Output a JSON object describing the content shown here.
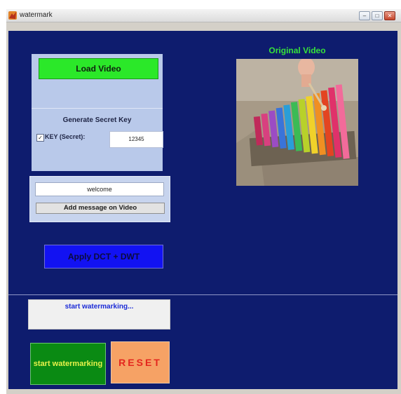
{
  "window": {
    "title": "watermark",
    "controls": {
      "minimize": "–",
      "maximize": "□",
      "close": "✕"
    }
  },
  "video_panel": {
    "title": "Original Video"
  },
  "load": {
    "button_label": "Load Video"
  },
  "secret_key": {
    "heading": "Generate Secret Key",
    "checkbox_label": "KEY (Secret):",
    "checked": true,
    "value": "12345"
  },
  "message": {
    "input_value": "welcome",
    "button_label": "Add message on Video"
  },
  "apply": {
    "button_label": "Apply DCT + DWT"
  },
  "status": {
    "text": "start watermarking..."
  },
  "actions": {
    "start_label": "start watermarking",
    "reset_label": "RESET"
  },
  "colors": {
    "canvas_bg": "#0e1c6e",
    "load_button": "#2be829",
    "apply_button": "#1212f2",
    "start_button": "#0a8a13",
    "reset_button": "#f6a265",
    "video_title": "#36e23a",
    "status_text": "#1b2bd6"
  }
}
